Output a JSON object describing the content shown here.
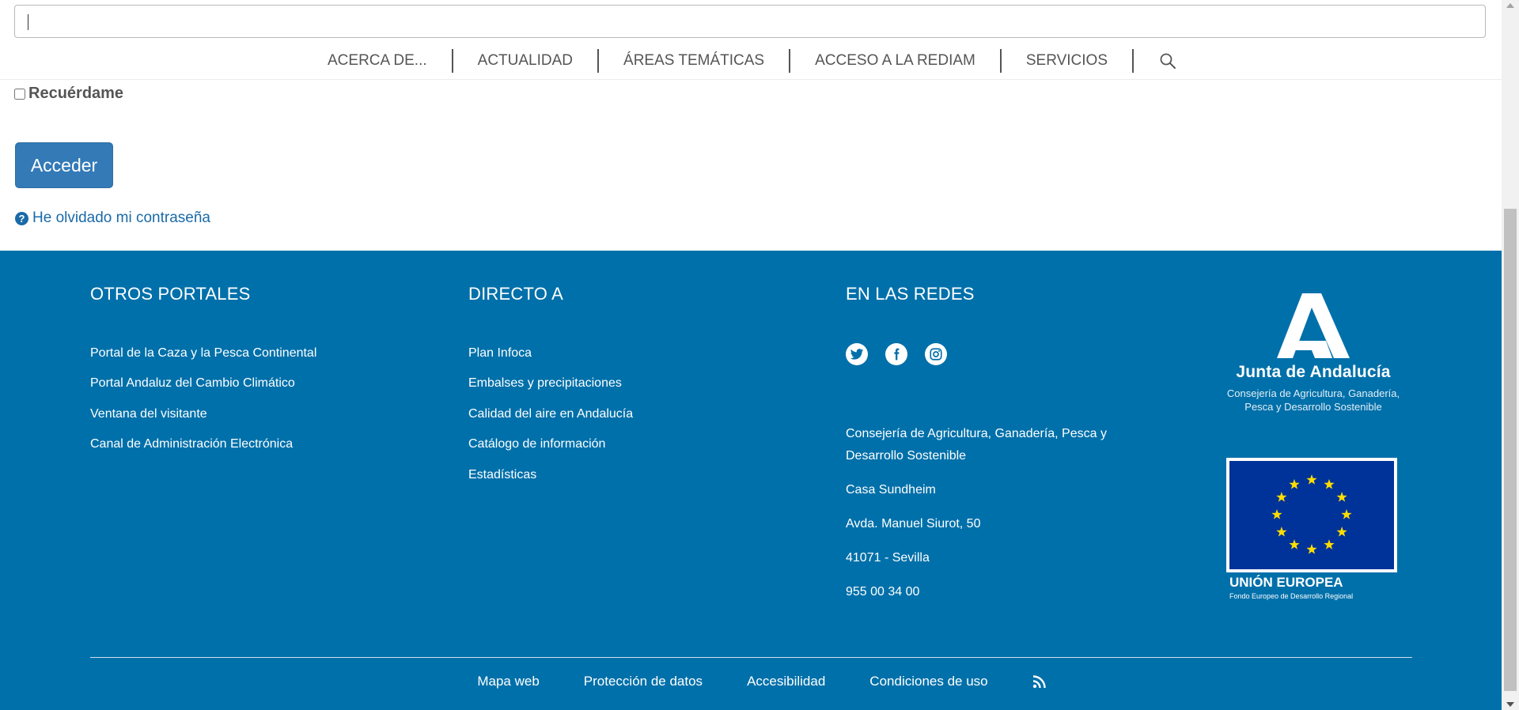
{
  "search": {
    "value": "",
    "placeholder": ""
  },
  "nav": {
    "items": [
      {
        "label": "ACERCA DE..."
      },
      {
        "label": "ACTUALIDAD"
      },
      {
        "label": "ÁREAS TEMÁTICAS"
      },
      {
        "label": "ACCESO A LA REDIAM"
      },
      {
        "label": "SERVICIOS"
      }
    ],
    "search_icon": "search-icon"
  },
  "login": {
    "remember_label": "Recuérdame",
    "submit_label": "Acceder",
    "forgot_label": "He olvidado mi contraseña",
    "forgot_icon": "question-circle-icon"
  },
  "footer": {
    "columns": [
      {
        "title": "OTROS PORTALES",
        "links": [
          "Portal de la Caza y la Pesca Continental",
          "Portal Andaluz del Cambio Climático",
          "Ventana del visitante",
          "Canal de Administración Electrónica"
        ]
      },
      {
        "title": "DIRECTO A",
        "links": [
          "Plan Infoca",
          "Embalses y precipitaciones",
          "Calidad del aire en Andalucía",
          "Catálogo de información",
          "Estadísticas"
        ]
      }
    ],
    "social": {
      "title": "EN LAS REDES",
      "icons": [
        "twitter-icon",
        "facebook-icon",
        "instagram-icon"
      ]
    },
    "address": {
      "organization": "Consejería de Agricultura, Ganadería, Pesca y Desarrollo Sostenible",
      "building": "Casa Sundheim",
      "street": "Avda. Manuel Siurot, 50",
      "city": "41071 - Sevilla",
      "phone": "955 00 34 00"
    },
    "logos": {
      "junta_name": "Junta de Andalucía",
      "junta_sub": "Consejería de Agricultura, Ganadería, Pesca y Desarrollo Sostenible",
      "eu_title": "UNIÓN EUROPEA",
      "eu_sub": "Fondo Europeo de Desarrollo Regional"
    },
    "bottom_links": [
      "Mapa web",
      "Protección de datos",
      "Accesibilidad",
      "Condiciones de uso"
    ],
    "rss_icon": "rss-icon"
  },
  "colors": {
    "footer_bg": "#0070aa",
    "button_bg": "#337ab7",
    "link": "#1a6aa8"
  }
}
